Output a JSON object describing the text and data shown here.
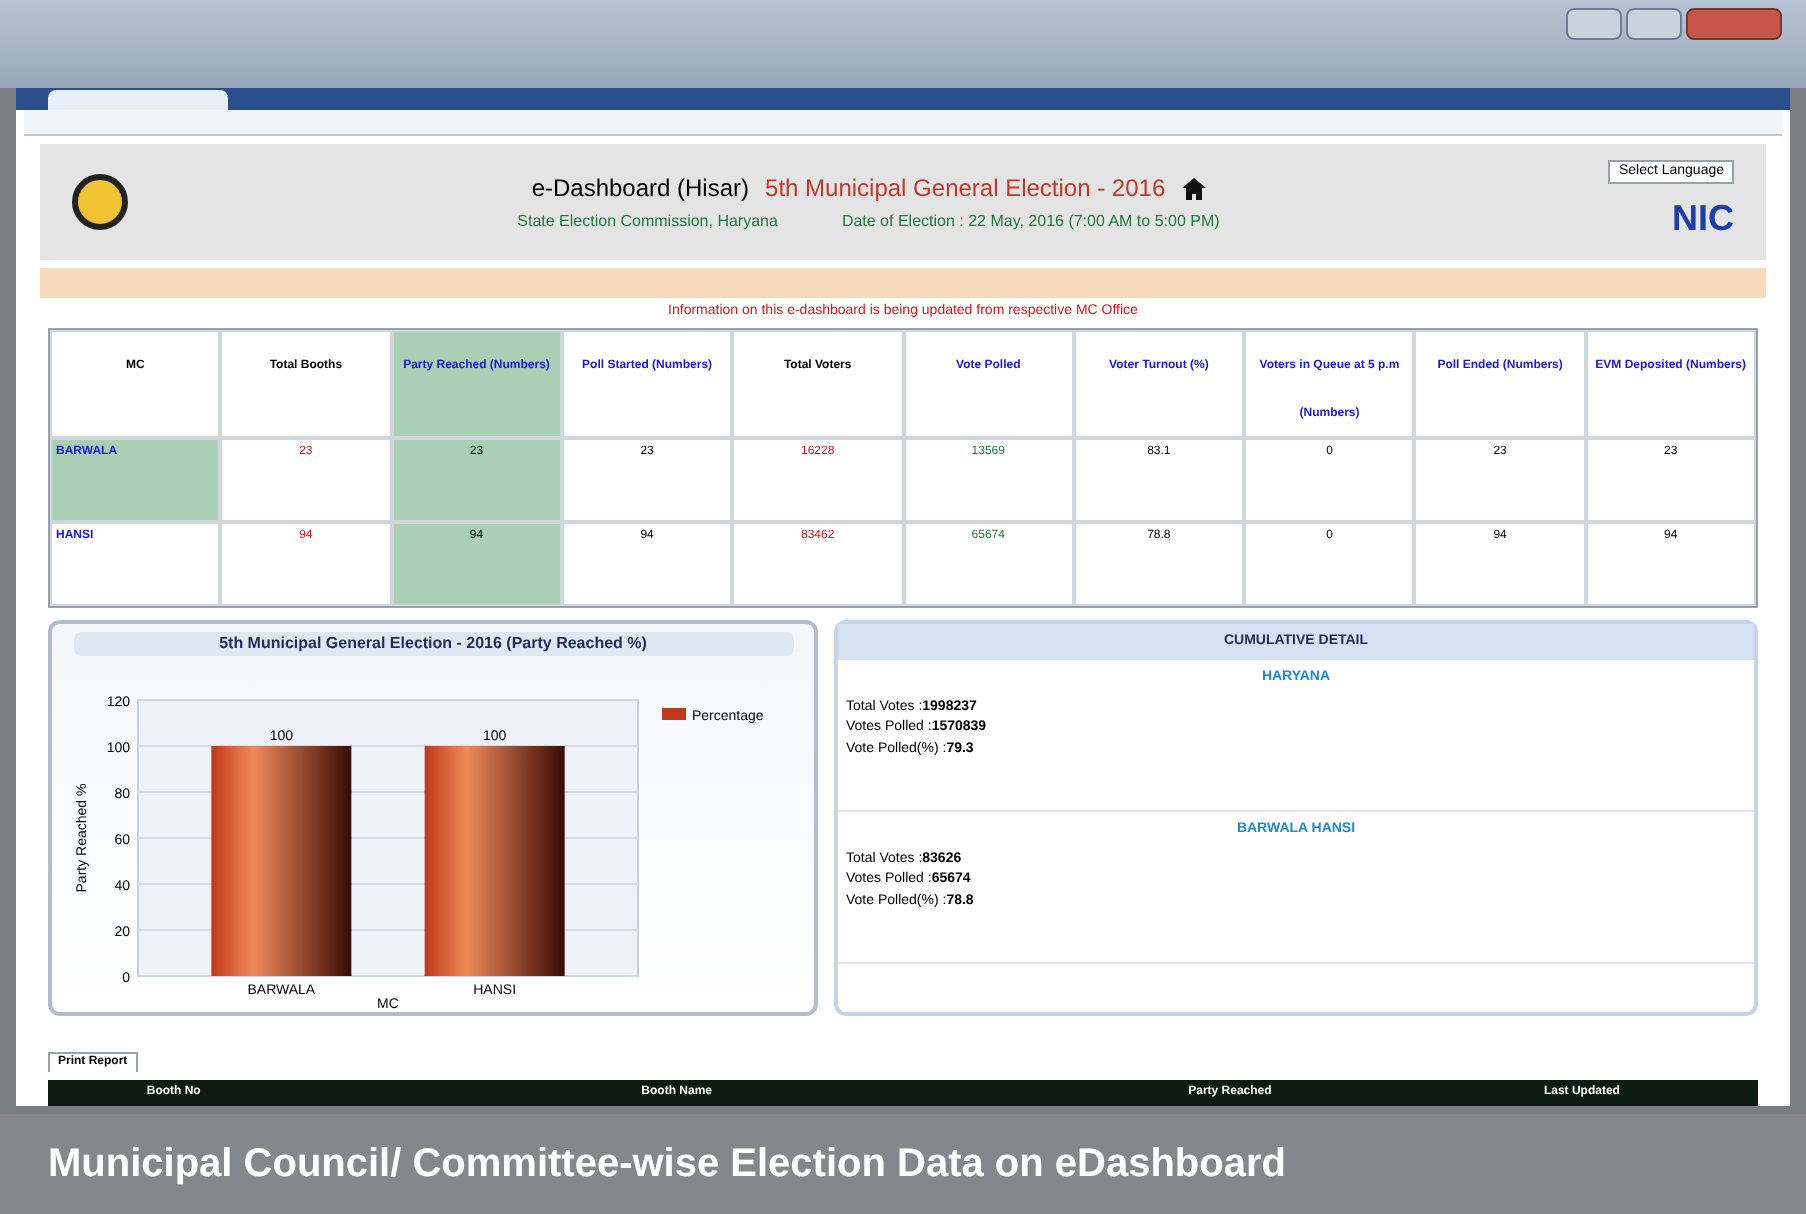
{
  "header": {
    "title": "e-Dashboard (Hisar)",
    "election": "5th Municipal General Election - 2016",
    "commission": "State Election Commission, Haryana",
    "date": "Date of Election : 22 May, 2016 (7:00 AM to 5:00 PM)",
    "language": "Select Language",
    "logo_text": "NIC"
  },
  "info": "Information on this e-dashboard is being updated from respective MC Office",
  "table": {
    "columns": [
      {
        "label": "MC",
        "color": "#000000"
      },
      {
        "label": "Total Booths",
        "color": "#000000"
      },
      {
        "label": "Party Reached (Numbers)",
        "color": "#1a1ad0"
      },
      {
        "label": "Poll Started (Numbers)",
        "color": "#1a1ad0"
      },
      {
        "label": "Total Voters",
        "color": "#000000"
      },
      {
        "label": "Vote Polled",
        "color": "#1a1ad0"
      },
      {
        "label": "Voter Turnout (%)",
        "color": "#1a1ad0"
      },
      {
        "label": "Voters in Queue at 5 p.m (Numbers)",
        "color": "#1a1ad0"
      },
      {
        "label": "Poll Ended (Numbers)",
        "color": "#1a1ad0"
      },
      {
        "label": "EVM Deposited (Numbers)",
        "color": "#1a1ad0"
      }
    ],
    "rows": [
      [
        "BARWALA",
        "23",
        "23",
        "23",
        "16228",
        "13569",
        "83.1",
        "0",
        "23",
        "23"
      ],
      [
        "HANSI",
        "94",
        "94",
        "94",
        "83462",
        "65674",
        "78.8",
        "0",
        "94",
        "94"
      ]
    ]
  },
  "chart": {
    "chart_data": {
      "type": "bar",
      "title": "5th Municipal General Election - 2016 (Party Reached %)",
      "xlabel": "MC",
      "ylabel": "Party Reached %",
      "categories": [
        "BARWALA",
        "HANSI"
      ],
      "series": [
        {
          "name": "Percentage",
          "color": "#c0391a",
          "values": [
            100,
            100
          ]
        }
      ],
      "grid": true,
      "ylim": [
        0,
        120
      ],
      "yticks": [
        0,
        20,
        40,
        60,
        80,
        100,
        120
      ],
      "data_labels": true
    }
  },
  "cumulative": {
    "title": "CUMULATIVE DETAIL",
    "groups": [
      {
        "name": "HARYANA",
        "lines": [
          {
            "label": "Total Votes : ",
            "value": "1998237"
          },
          {
            "label": "Votes Polled : ",
            "value": "1570839"
          },
          {
            "label": "Vote Polled(%) : ",
            "value": "79.3"
          }
        ]
      },
      {
        "name": "BARWALA  HANSI",
        "lines": [
          {
            "label": "Total Votes : ",
            "value": "83626"
          },
          {
            "label": "Votes Polled : ",
            "value": "65674"
          },
          {
            "label": "Vote Polled(%) : ",
            "value": "78.8"
          }
        ]
      }
    ]
  },
  "report_tab": "Print Report",
  "booth_columns": [
    "Booth No",
    "Booth Name",
    "Party Reached",
    "Last Updated"
  ],
  "caption": "Municipal Council/ Committee-wise Election Data on eDashboard"
}
